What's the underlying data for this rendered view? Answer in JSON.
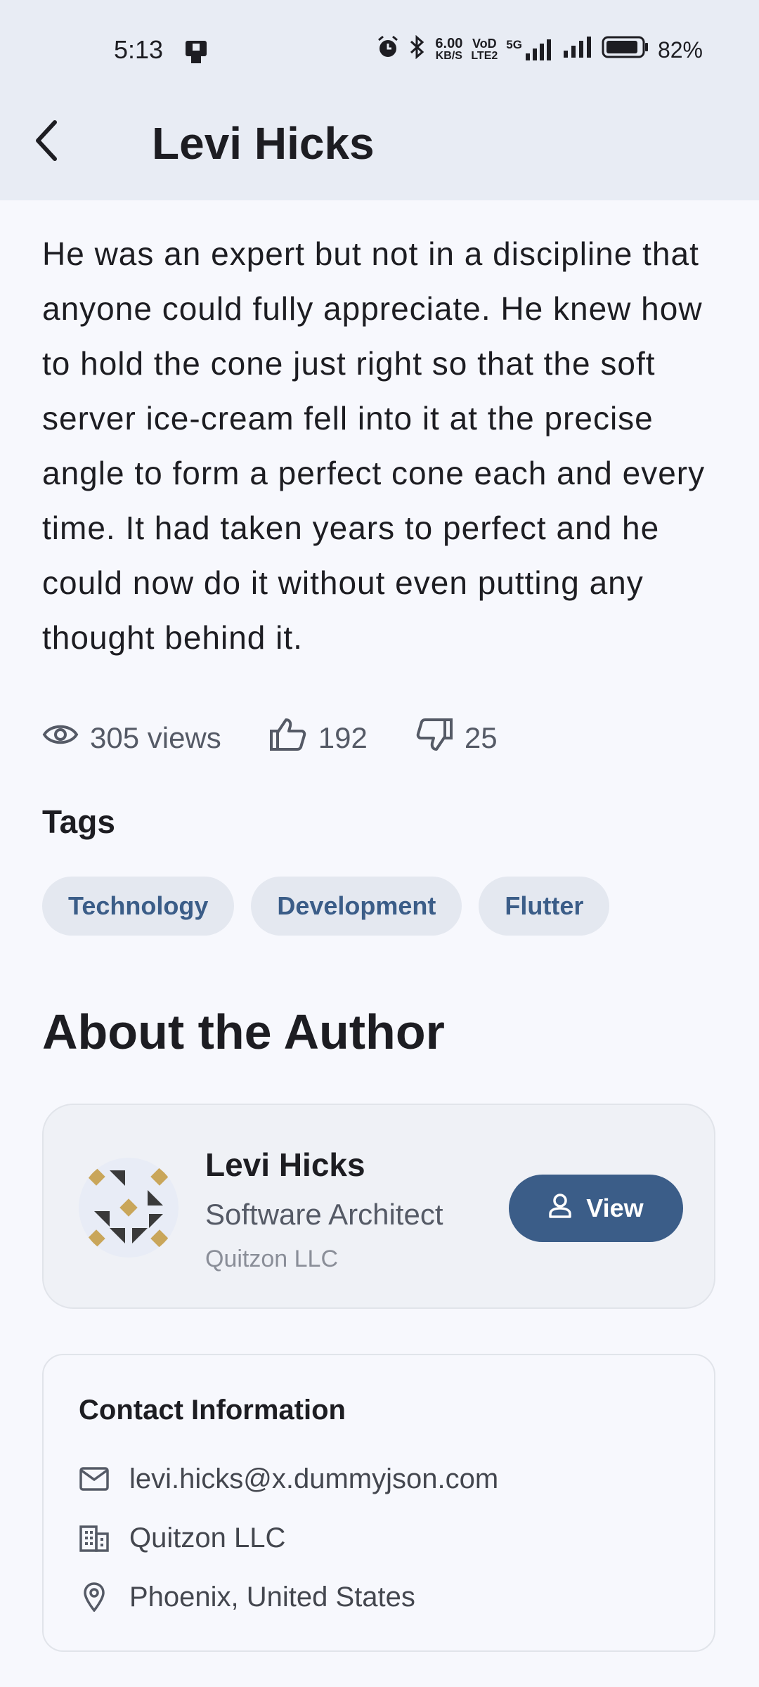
{
  "status_bar": {
    "time": "5:13",
    "net_speed_top": "6.00",
    "net_speed_bottom": "KB/S",
    "volte_top": "VoD",
    "volte_bottom": "LTE2",
    "network": "5G",
    "battery": "82%"
  },
  "app_bar": {
    "title": "Levi Hicks"
  },
  "post": {
    "body": "He was an expert but not in a discipline that anyone could fully appreciate. He knew how to hold the cone just right so that the soft server ice-cream fell into it at the precise angle to form a perfect cone each and every time. It had taken years to perfect and he could now do it without even putting any thought behind it.",
    "views": "305 views",
    "likes": "192",
    "dislikes": "25"
  },
  "tags": {
    "heading": "Tags",
    "items": [
      "Technology",
      "Development",
      "Flutter"
    ]
  },
  "author": {
    "heading": "About the Author",
    "name": "Levi Hicks",
    "role": "Software Architect",
    "company": "Quitzon LLC",
    "view_label": "View"
  },
  "contact": {
    "title": "Contact Information",
    "email": "levi.hicks@x.dummyjson.com",
    "company": "Quitzon LLC",
    "location": "Phoenix, United States"
  },
  "colors": {
    "accent": "#3b5d88",
    "chip_bg": "#e4e8f0",
    "app_bar_bg": "#e8ecf4",
    "page_bg": "#f7f8fd",
    "avatar_gold": "#c9a65a",
    "avatar_dark": "#3a3a3a"
  }
}
